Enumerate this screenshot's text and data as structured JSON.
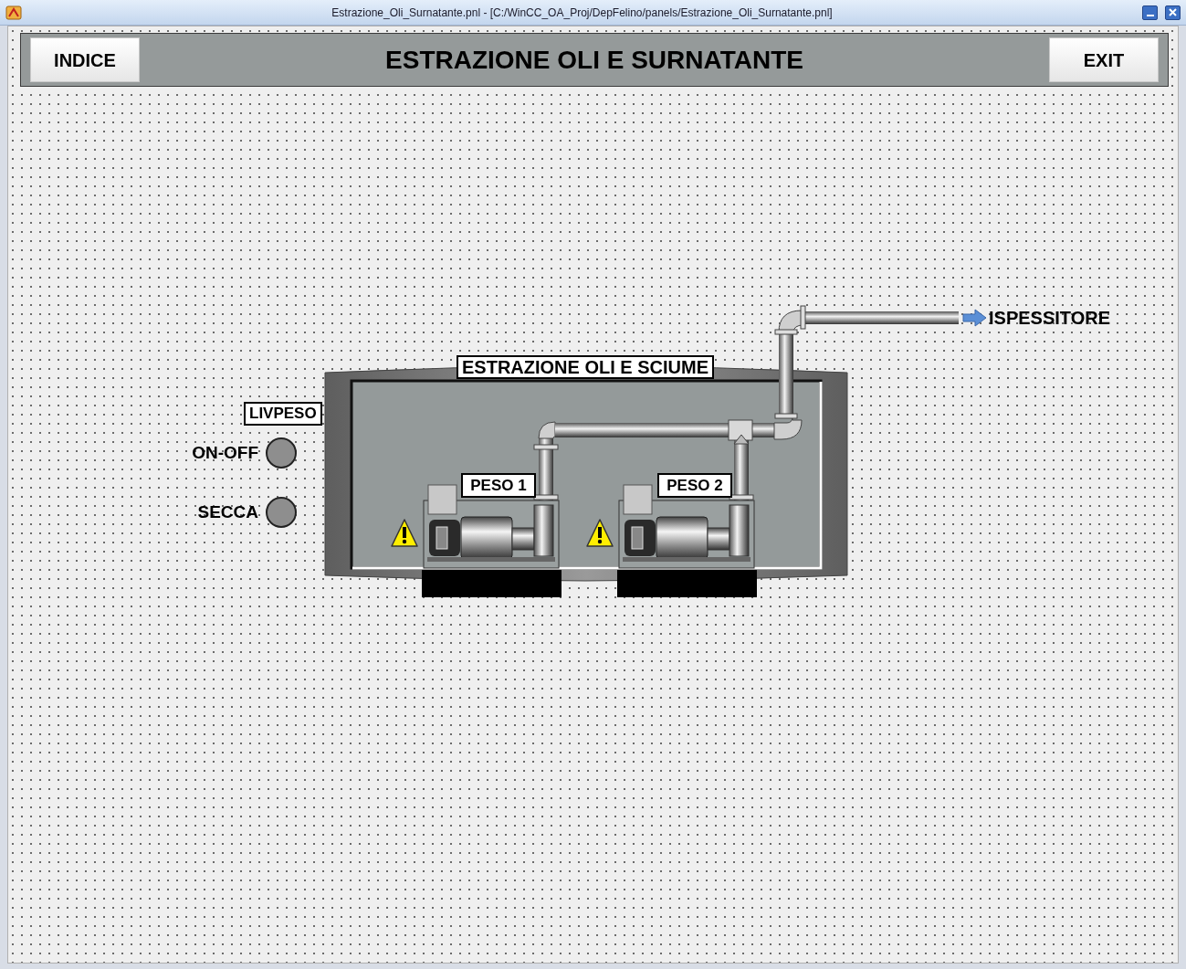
{
  "window": {
    "title": "Estrazione_Oli_Surnatante.pnl - [C:/WinCC_OA_Proj/DepFelino/panels/Estrazione_Oli_Surnatante.pnl]"
  },
  "header": {
    "title": "ESTRAZIONE OLI E SURNATANTE",
    "buttons": [
      {
        "label": "INDICE"
      },
      {
        "label": "EXIT"
      }
    ]
  },
  "tank": {
    "title": "ESTRAZIONE OLI E SCIUME"
  },
  "destination": {
    "label": "ISPESSITORE"
  },
  "livpeso": {
    "title": "LIVPESO",
    "indicators": [
      {
        "label": "ON-OFF",
        "on": false
      },
      {
        "label": "SECCA",
        "on": false
      }
    ]
  },
  "pumps": [
    {
      "label": "PESO 1",
      "alarm": true
    },
    {
      "label": "PESO 2",
      "alarm": true
    }
  ]
}
